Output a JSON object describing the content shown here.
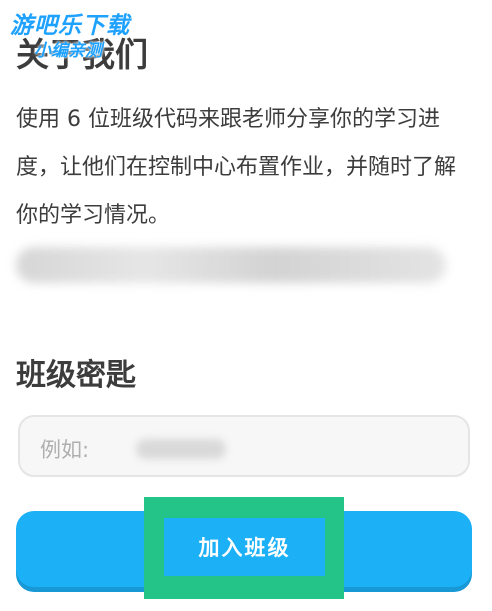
{
  "watermark": {
    "line1": "游吧乐下载",
    "line2": "小编亲测"
  },
  "about": {
    "title": "关于我们",
    "body": "使用 6 位班级代码来跟老师分享你的学习进度，让他们在控制中心布置作业，并随时了解你的学习情况。"
  },
  "class_code": {
    "title": "班级密匙",
    "placeholder": "例如:"
  },
  "join_button": {
    "label": "加入班级"
  },
  "colors": {
    "button_blue": "#1cb0f6",
    "highlight_green": "#24c488",
    "text_dark": "#3c3c3c"
  }
}
